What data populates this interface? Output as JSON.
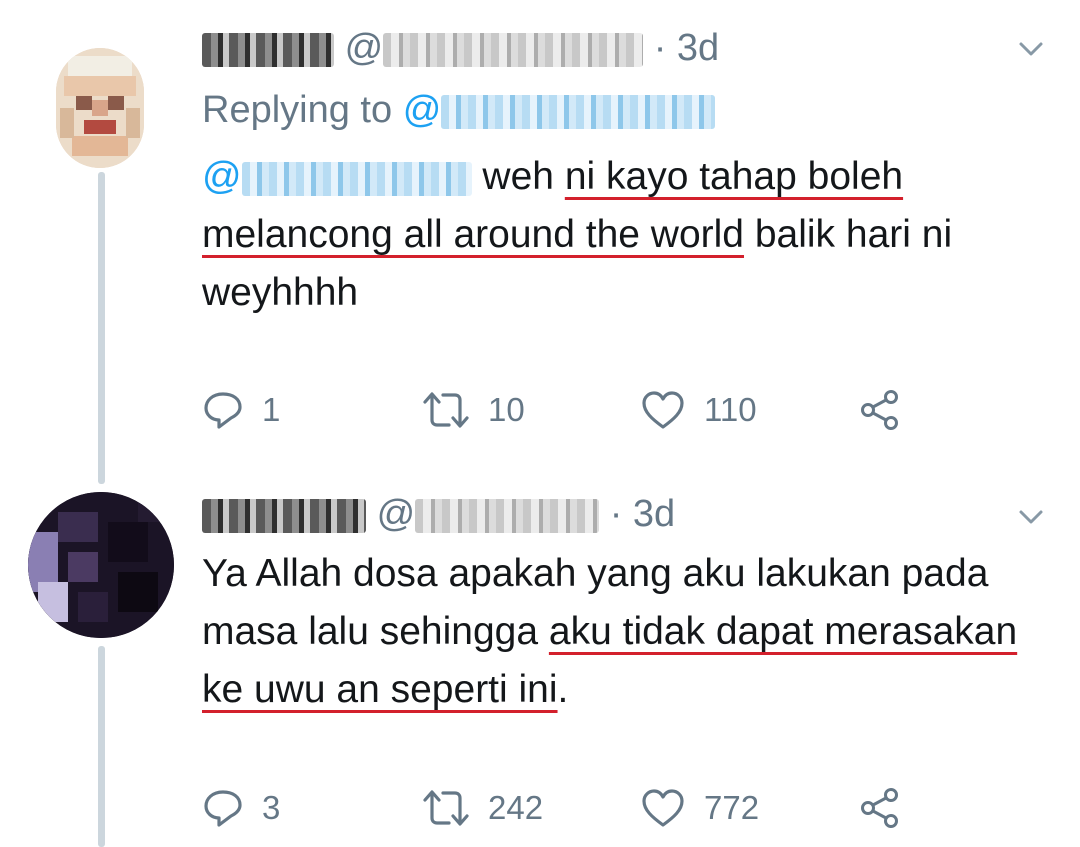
{
  "tweets": [
    {
      "timestamp": "3d",
      "at_symbol": "@",
      "separator": "·",
      "replying_label": "Replying to",
      "reply_at": "@",
      "body": {
        "mention_at": "@",
        "t1": " weh ",
        "u1": "ni kayo tahap boleh",
        "t2": " ",
        "u2": "melancong all around the world",
        "t3": " balik hari ni weyhhhh"
      },
      "actions": {
        "replies": "1",
        "retweets": "10",
        "likes": "110"
      },
      "icons": [
        "reply-icon",
        "retweet-icon",
        "like-icon",
        "share-icon"
      ]
    },
    {
      "timestamp": "3d",
      "at_symbol": "@",
      "separator": "·",
      "body": {
        "t1": "Ya Allah dosa apakah yang aku lakukan pada masa lalu sehingga ",
        "u1": "aku tidak dapat merasakan ke uwu an seperti ini",
        "t2": "."
      },
      "actions": {
        "replies": "3",
        "retweets": "242",
        "likes": "772"
      },
      "icons": [
        "reply-icon",
        "retweet-icon",
        "like-icon",
        "share-icon"
      ]
    }
  ],
  "colors": {
    "text": "#14171a",
    "secondary": "#657786",
    "link": "#1da1f2",
    "underline": "#d3202c",
    "thread": "#ccd6dd"
  }
}
